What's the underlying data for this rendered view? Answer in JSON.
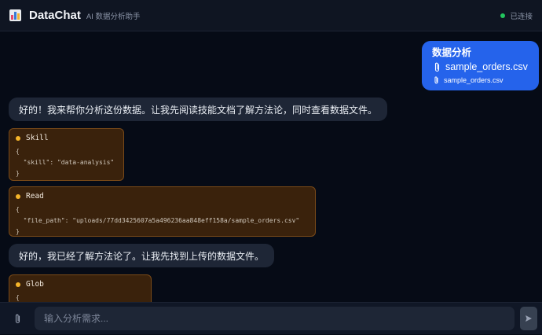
{
  "header": {
    "title": "DataChat",
    "subtitle": "AI 数据分析助手",
    "status": "已连接",
    "logo_icon": "bar-chart-icon"
  },
  "messages": {
    "user": {
      "text": "数据分析",
      "attachment_name": "sample_orders.csv",
      "attachment_small": "sample_orders.csv"
    },
    "ai_1": "好的！我来帮你分析这份数据。让我先阅读技能文档了解方法论，同时查看数据文件。",
    "tool_skill": {
      "name": "Skill",
      "line1": "{",
      "line2": "  \"skill\": \"data-analysis\"",
      "line3": "}"
    },
    "tool_read": {
      "name": "Read",
      "line1": "{",
      "line2": "  \"file_path\": \"uploads/77dd3425607a5a496236aa848eff158a/sample_orders.csv\"",
      "line3": "}"
    },
    "ai_2": "好的，我已经了解方法论了。让我先找到上传的数据文件。",
    "tool_glob": {
      "name": "Glob",
      "line1": "{"
    }
  },
  "input": {
    "placeholder": "输入分析需求..."
  },
  "colors": {
    "accent": "#2563eb",
    "status_online": "#22c55e",
    "tool_dot": "#f5b52a"
  }
}
